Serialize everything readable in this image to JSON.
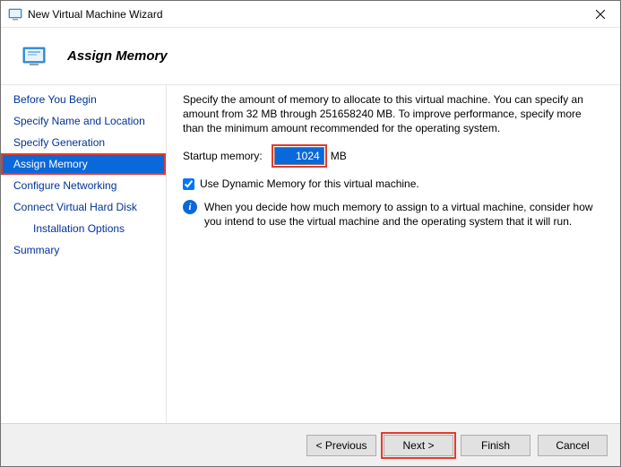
{
  "window": {
    "title": "New Virtual Machine Wizard"
  },
  "header": {
    "heading": "Assign Memory"
  },
  "nav": {
    "items": [
      {
        "label": "Before You Begin"
      },
      {
        "label": "Specify Name and Location"
      },
      {
        "label": "Specify Generation"
      },
      {
        "label": "Assign Memory",
        "selected": true
      },
      {
        "label": "Configure Networking"
      },
      {
        "label": "Connect Virtual Hard Disk"
      },
      {
        "label": "Installation Options",
        "indent": true
      },
      {
        "label": "Summary"
      }
    ]
  },
  "content": {
    "intro": "Specify the amount of memory to allocate to this virtual machine. You can specify an amount from 32 MB through 251658240 MB. To improve performance, specify more than the minimum amount recommended for the operating system.",
    "startup_label": "Startup memory:",
    "startup_value": "1024",
    "startup_unit": "MB",
    "dynamic_label": "Use Dynamic Memory for this virtual machine.",
    "dynamic_checked": true,
    "info_text": "When you decide how much memory to assign to a virtual machine, consider how you intend to use the virtual machine and the operating system that it will run."
  },
  "footer": {
    "previous": "< Previous",
    "next": "Next >",
    "finish": "Finish",
    "cancel": "Cancel"
  }
}
